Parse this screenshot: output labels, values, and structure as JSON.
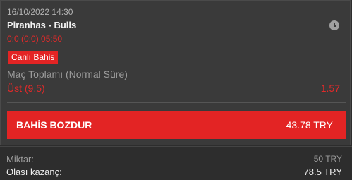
{
  "bet": {
    "date": "16/10/2022 14:30",
    "match": "Piranhas - Bulls",
    "score": "0:0 (0:0) 05:50",
    "live_badge": "Canlı Bahis",
    "market": "Maç Toplamı (Normal Süre)",
    "selection": "Üst (9.5)",
    "odds": "1.57",
    "status_icon": "clock-icon"
  },
  "cashout": {
    "label": "BAHİS BOZDUR",
    "amount": "43.78 TRY"
  },
  "summary": {
    "stake_label": "Miktar:",
    "stake_value": "50 TRY",
    "win_label": "Olası kazanç:",
    "win_value": "78.5 TRY"
  },
  "colors": {
    "accent": "#e32424",
    "card_bg": "#3a3a3a",
    "page_bg": "#2d2d2d"
  }
}
